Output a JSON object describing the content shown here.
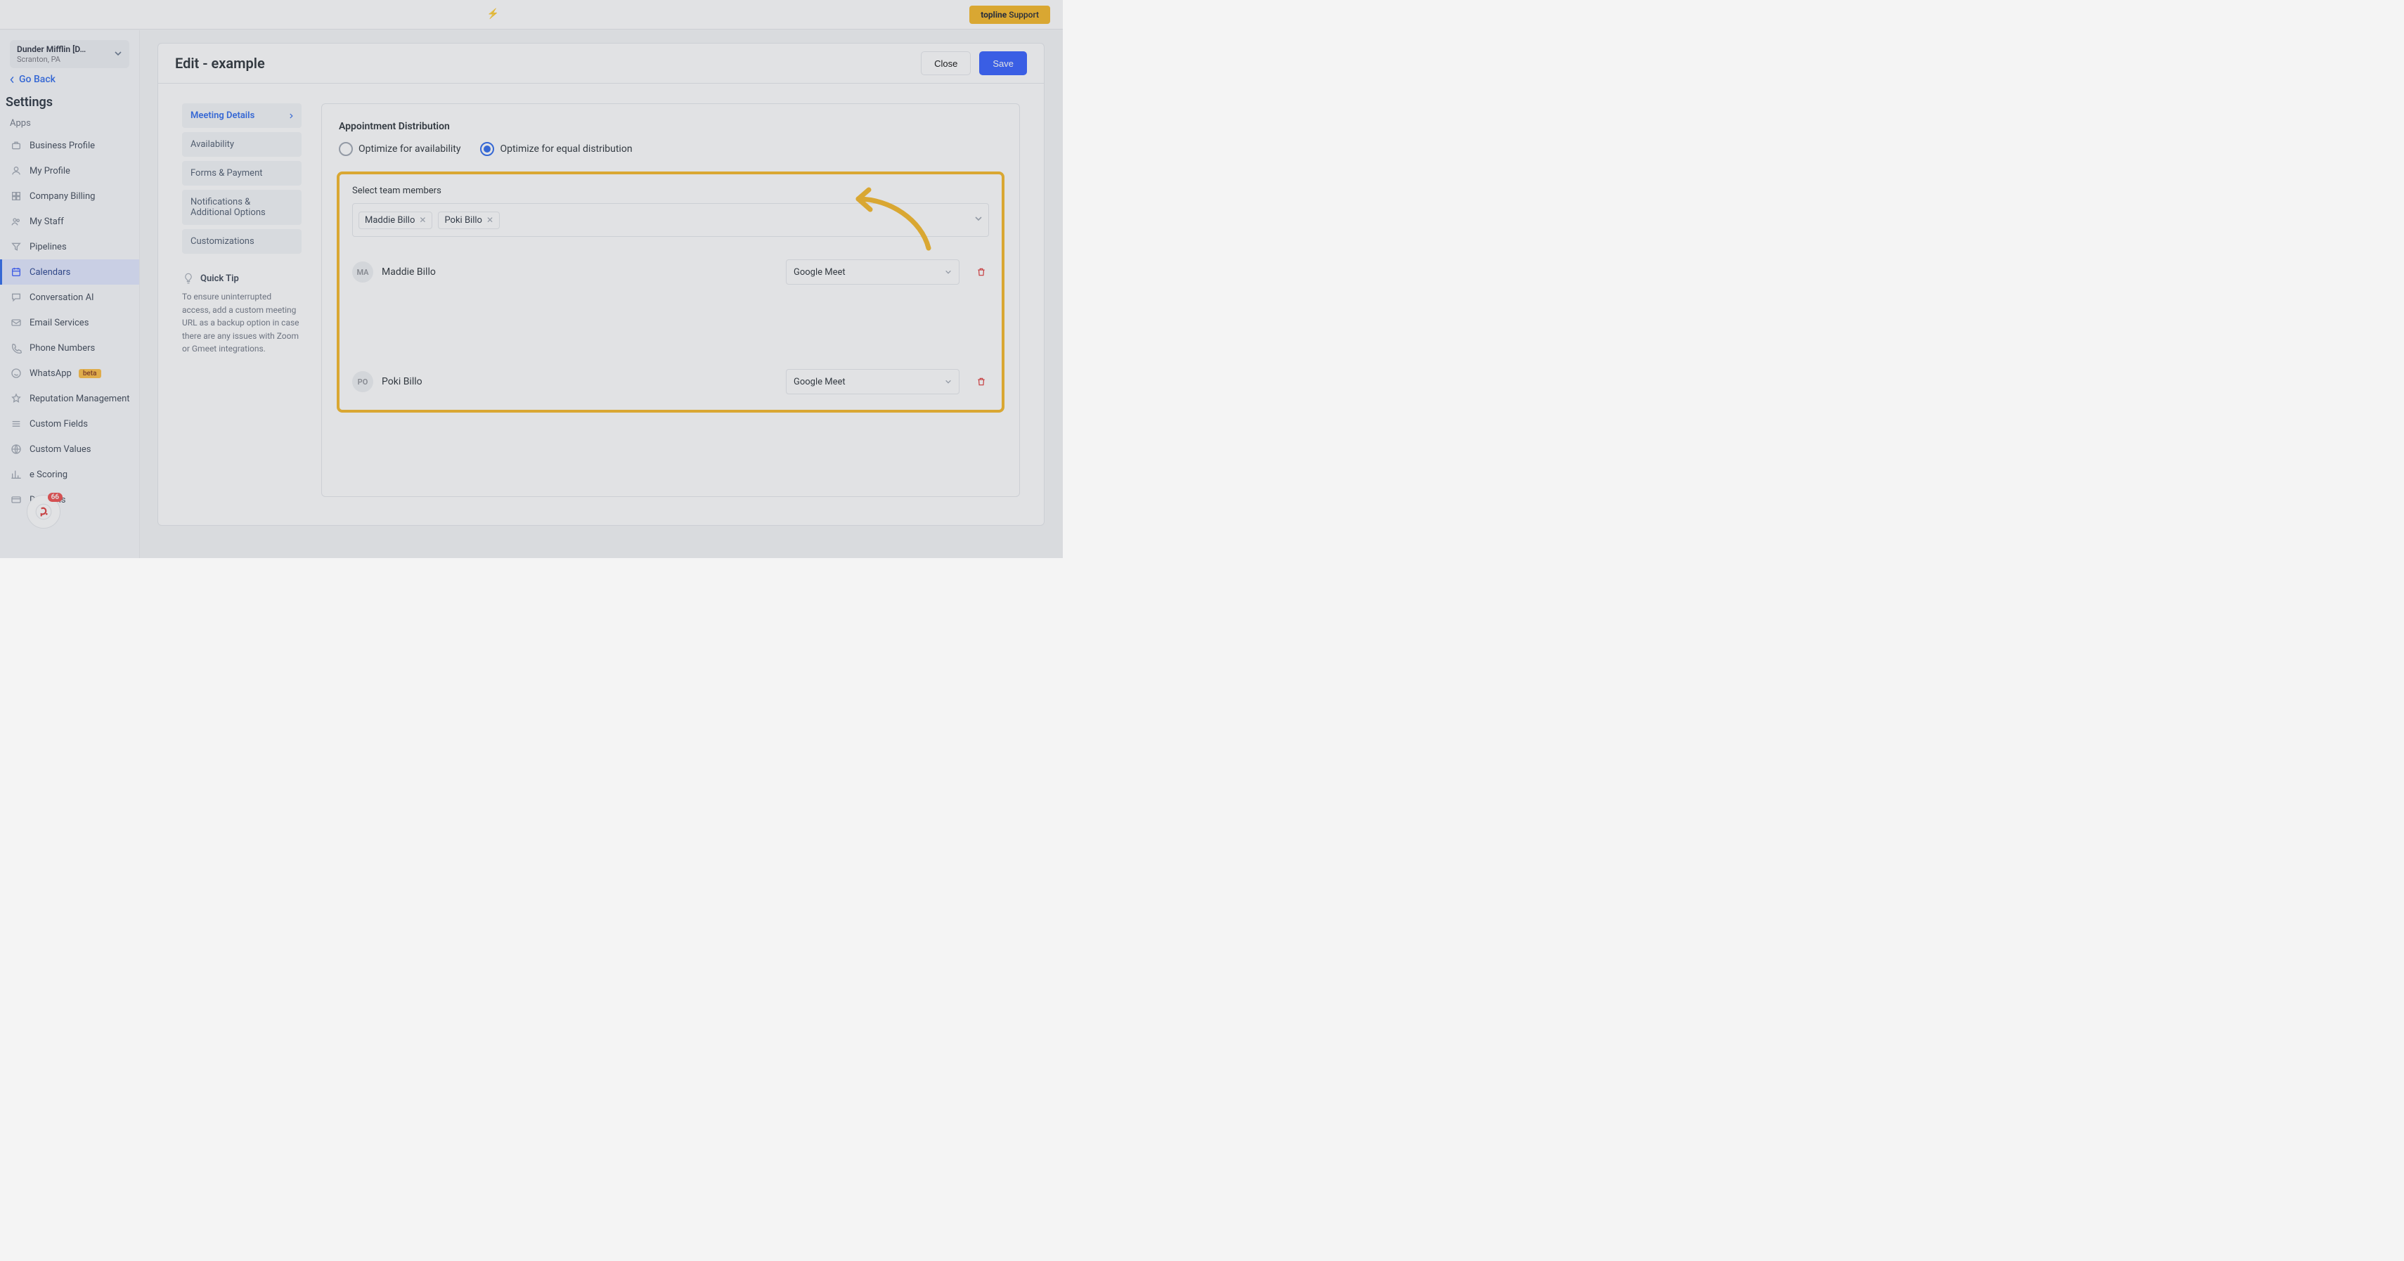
{
  "support": {
    "brand": "topline",
    "label": "Support"
  },
  "topbar_hint": "",
  "org": {
    "title": "Dunder Mifflin [D…",
    "sub": "Scranton, PA"
  },
  "go_back": "Go Back",
  "settings_title": "Settings",
  "section_label": "Apps",
  "sidebar": {
    "items": [
      {
        "id": "business-profile",
        "label": "Business Profile"
      },
      {
        "id": "my-profile",
        "label": "My Profile"
      },
      {
        "id": "company-billing",
        "label": "Company Billing"
      },
      {
        "id": "my-staff",
        "label": "My Staff"
      },
      {
        "id": "pipelines",
        "label": "Pipelines"
      },
      {
        "id": "calendars",
        "label": "Calendars",
        "active": true
      },
      {
        "id": "conversation-ai",
        "label": "Conversation AI"
      },
      {
        "id": "email-services",
        "label": "Email Services"
      },
      {
        "id": "phone-numbers",
        "label": "Phone Numbers"
      },
      {
        "id": "whatsapp",
        "label": "WhatsApp",
        "badge": "beta"
      },
      {
        "id": "reputation",
        "label": "Reputation Management"
      },
      {
        "id": "custom-fields",
        "label": "Custom Fields"
      },
      {
        "id": "custom-values",
        "label": "Custom Values"
      },
      {
        "id": "scoring",
        "label": "e Scoring"
      },
      {
        "id": "domains",
        "label": "Domains"
      }
    ]
  },
  "page": {
    "title": "Edit - example",
    "close": "Close",
    "save": "Save"
  },
  "tabs": [
    {
      "id": "meeting-details",
      "label": "Meeting Details",
      "active": true
    },
    {
      "id": "availability",
      "label": "Availability"
    },
    {
      "id": "forms",
      "label": "Forms & Payment"
    },
    {
      "id": "notifications",
      "label": "Notifications & Additional Options"
    },
    {
      "id": "customizations",
      "label": "Customizations"
    }
  ],
  "tip": {
    "title": "Quick Tip",
    "body": "To ensure uninterrupted access, add a custom meeting URL as a backup option in case there are any issues with Zoom or Gmeet integrations."
  },
  "distribution": {
    "title": "Appointment Distribution",
    "options": [
      {
        "id": "availability",
        "label": "Optimize for availability",
        "checked": false
      },
      {
        "id": "equal",
        "label": "Optimize for equal distribution",
        "checked": true
      }
    ]
  },
  "team": {
    "title": "Select team members",
    "chips": [
      {
        "name": "Maddie Billo"
      },
      {
        "name": "Poki Billo"
      }
    ],
    "rows": [
      {
        "initials": "MA",
        "name": "Maddie Billo",
        "integration": "Google Meet"
      },
      {
        "initials": "PO",
        "name": "Poki Billo",
        "integration": "Google Meet"
      }
    ]
  },
  "assistant_badge": "66"
}
